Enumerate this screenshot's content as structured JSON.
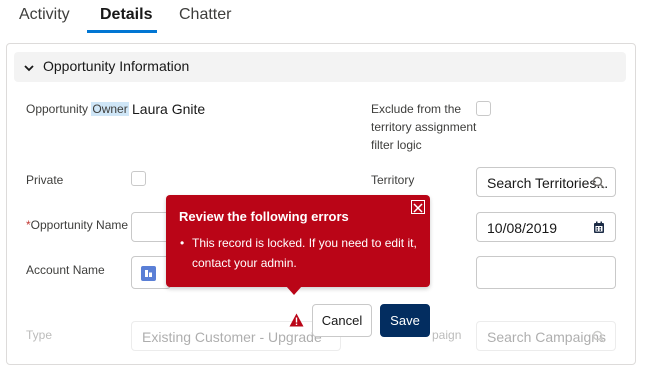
{
  "tabs": [
    {
      "label": "Activity"
    },
    {
      "label": "Details"
    },
    {
      "label": "Chatter"
    }
  ],
  "section": {
    "title": "Opportunity Information"
  },
  "fields": {
    "owner": {
      "label_prefix": "Opportunity ",
      "label_highlight": "Owner",
      "value": "Laura Gnite"
    },
    "exclude": {
      "label_line1": "Exclude from the",
      "label_line2": "territory assignment",
      "label_line3": "filter logic"
    },
    "private": {
      "label": "Private"
    },
    "territory": {
      "label": "Territory",
      "placeholder": "Search Territories..."
    },
    "name": {
      "required_mark": "*",
      "label": "Opportunity Name"
    },
    "close_date": {
      "value": "10/08/2019"
    },
    "account": {
      "label": "Account Name"
    },
    "type": {
      "label": "Type",
      "value": "Existing Customer - Upgrade"
    },
    "campaign": {
      "label_partial": "paign",
      "placeholder": "Search Campaigns"
    }
  },
  "error_popover": {
    "title": "Review the following errors",
    "bullet": "•",
    "message": "This record is locked. If you need to edit it, contact your admin."
  },
  "buttons": {
    "cancel": "Cancel",
    "save": "Save"
  },
  "colors": {
    "brand": "#0176d3",
    "error": "#ba0517",
    "save": "#032d60",
    "highlight": "#cfe6f7"
  }
}
